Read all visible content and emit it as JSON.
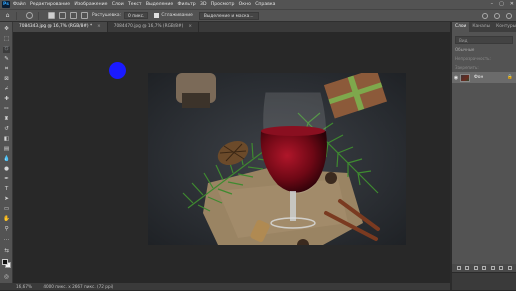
{
  "app": {
    "logo": "Ps"
  },
  "menu": [
    "Файл",
    "Редактирование",
    "Изображение",
    "Слои",
    "Текст",
    "Выделение",
    "Фильтр",
    "3D",
    "Просмотр",
    "Окно",
    "Справка"
  ],
  "window_controls": {
    "minimize": "–",
    "maximize": "▢",
    "close": "✕"
  },
  "options": {
    "feather_label": "Растушевка:",
    "feather_value": "0 пикс.",
    "antialias_label": "Сглаживание",
    "select_mask_label": "Выделение и маска..."
  },
  "tabs": [
    {
      "label": "7084343.jpg @ 16,7% (RGB/8#) *",
      "close": "×"
    },
    {
      "label": "7084470.jpg @ 16,7% (RGB/8#)",
      "close": "×"
    }
  ],
  "status": {
    "zoom": "16,67%",
    "size": "4000 пикс. x 2667 пикс. (72 ppi)"
  },
  "panel": {
    "tabs": [
      "Слои",
      "Каналы",
      "Контуры"
    ],
    "search_placeholder": "Вид",
    "blend_mode": "Обычные",
    "opacity_label": "Непрозрачность:",
    "lock_label": "Закрепить:",
    "fill_label": "Заливка:",
    "layer_name": "Фон"
  },
  "icons": {
    "eye": "eye-icon",
    "lock": "lock-icon",
    "move": "move-icon",
    "lasso": "lasso-icon"
  }
}
